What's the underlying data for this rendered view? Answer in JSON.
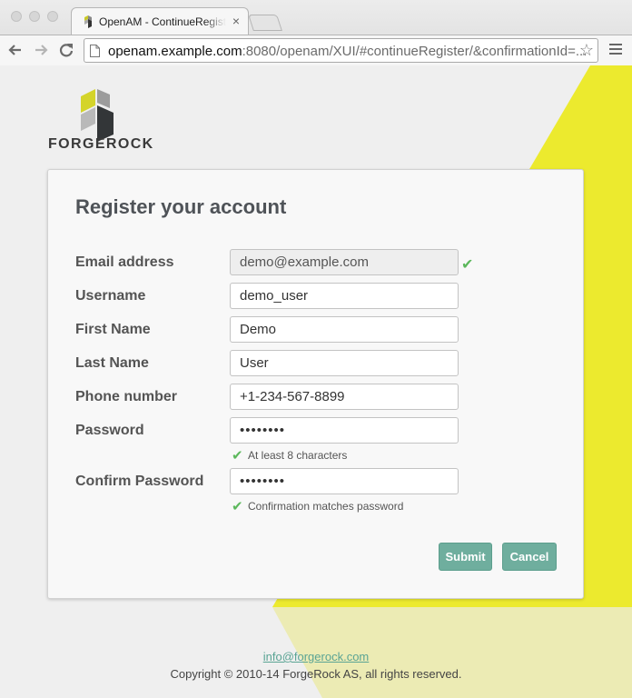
{
  "browser": {
    "tab_title": "OpenAM - ContinueRegister",
    "tab_close": "×",
    "url_host": "openam.example.com",
    "url_path": ":8080/openam/XUI/#continueRegister/&confirmationId=...",
    "back_icon": "arrow-left-icon",
    "forward_icon": "arrow-right-icon",
    "reload_icon": "reload-icon",
    "star_icon": "star-icon",
    "menu_icon": "hamburger-menu-icon"
  },
  "brand": {
    "name": "FORGEROCK"
  },
  "form": {
    "title": "Register your account",
    "fields": [
      {
        "label": "Email address",
        "value": "demo@example.com",
        "readonly": true,
        "valid": true
      },
      {
        "label": "Username",
        "value": "demo_user"
      },
      {
        "label": "First Name",
        "value": "Demo"
      },
      {
        "label": "Last Name",
        "value": "User"
      },
      {
        "label": "Phone number",
        "value": "+1-234-567-8899"
      },
      {
        "label": "Password",
        "value": "••••••••",
        "hint": "At least 8 characters"
      },
      {
        "label": "Confirm Password",
        "value": "••••••••",
        "hint": "Confirmation matches password"
      }
    ],
    "submit_label": "Submit",
    "cancel_label": "Cancel",
    "check_glyph": "✔"
  },
  "colors": {
    "accent_yellow": "#ecea2e",
    "button_teal": "#6fae9e",
    "valid_green": "#5cb85c"
  },
  "footer": {
    "email": "info@forgerock.com",
    "copyright": "Copyright © 2010-14 ForgeRock AS, all rights reserved."
  }
}
